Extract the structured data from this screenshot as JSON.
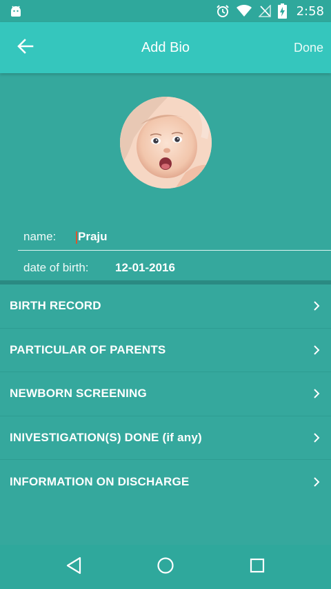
{
  "status_bar": {
    "time": "2:58",
    "icons": [
      "android-icon",
      "alarm-icon",
      "wifi-icon",
      "no-signal-icon",
      "battery-charging-icon"
    ]
  },
  "app_bar": {
    "title": "Add Bio",
    "done_label": "Done",
    "back_icon": "arrow-left-icon"
  },
  "profile": {
    "avatar": "baby-photo"
  },
  "bio": {
    "name_label": "name:",
    "name_value": "Praju",
    "dob_label": "date of birth:",
    "dob_value": "12-01-2016"
  },
  "menu": {
    "items": [
      {
        "label": "BIRTH RECORD"
      },
      {
        "label": "PARTICULAR OF PARENTS"
      },
      {
        "label": "NEWBORN SCREENING"
      },
      {
        "label": "INIVESTIGATION(S) DONE (if any)"
      },
      {
        "label": "INFORMATION ON DISCHARGE"
      }
    ]
  },
  "nav_bar": {
    "buttons": [
      "back-triangle-icon",
      "home-circle-icon",
      "recents-square-icon"
    ]
  },
  "colors": {
    "app_bar": "#35c6bd",
    "background": "#35a89d",
    "divider": "#2a8a82",
    "cursor": "#d8562f"
  }
}
